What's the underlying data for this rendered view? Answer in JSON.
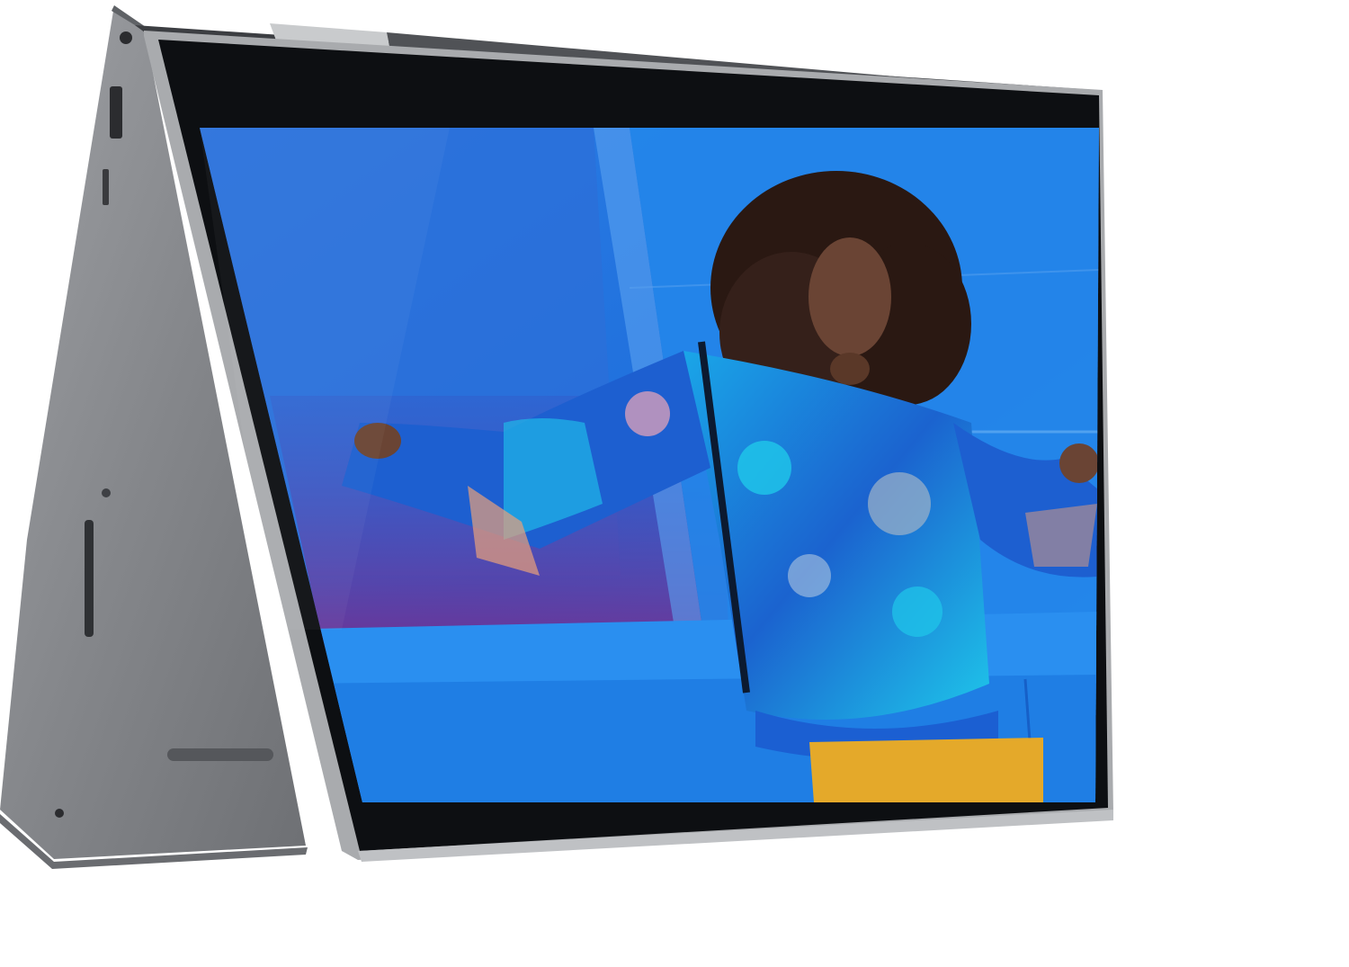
{
  "scene": {
    "subject": "laptop-tent-mode",
    "colors": {
      "background": "#ffffff",
      "chassis": "#8d8f93",
      "chassis_dark": "#5f6266",
      "chassis_light": "#b9bbbe",
      "bezel": "#0d0f12",
      "hinge": "#c9cbcd",
      "sky_blue": "#1f7fe0",
      "wall_blue": "#2a83e4",
      "wall_dark": "#1a5ec0",
      "magenta_reflection": "#6b3a9c",
      "jacket_cyan": "#1fb8e8",
      "jacket_blue": "#1d5fd0",
      "pants_yellow": "#e4a92a",
      "skin": "#6a4434",
      "hair": "#2a1812"
    },
    "icons": [
      "headphone-jack-icon",
      "usb-a-port-icon",
      "sd-card-slot-icon",
      "power-indicator-icon",
      "speaker-grille-icon",
      "pinhole-icon"
    ]
  }
}
